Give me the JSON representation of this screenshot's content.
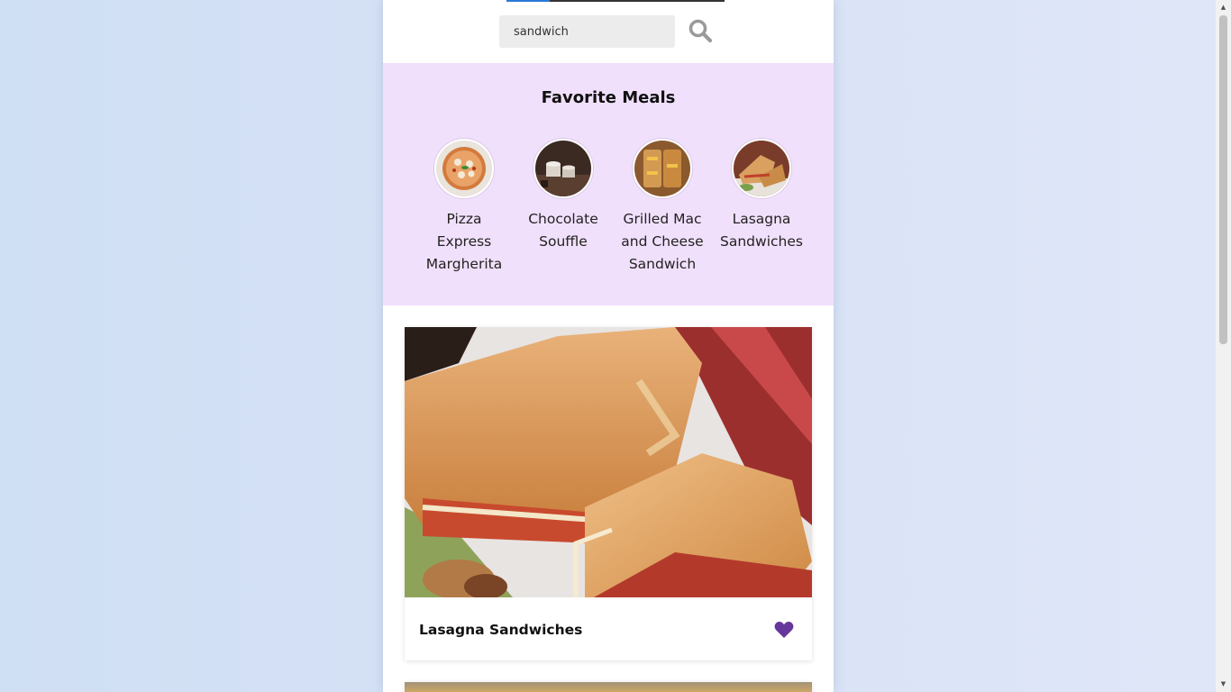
{
  "search": {
    "value": "sandwich",
    "placeholder": "",
    "button_icon": "search-icon"
  },
  "favorites": {
    "title": "Favorite Meals",
    "items": [
      {
        "name": "Pizza Express Margherita"
      },
      {
        "name": "Chocolate Souffle"
      },
      {
        "name": "Grilled Mac and Cheese Sandwich"
      },
      {
        "name": "Lasagna Sandwiches"
      }
    ]
  },
  "results": [
    {
      "title": "Lasagna Sandwiches",
      "favorite_icon": "heart-icon",
      "favorited": true
    }
  ],
  "colors": {
    "accent": "#66379a",
    "favorites_bg": "#f1e0fb",
    "active_tab": "#2b79d6"
  }
}
